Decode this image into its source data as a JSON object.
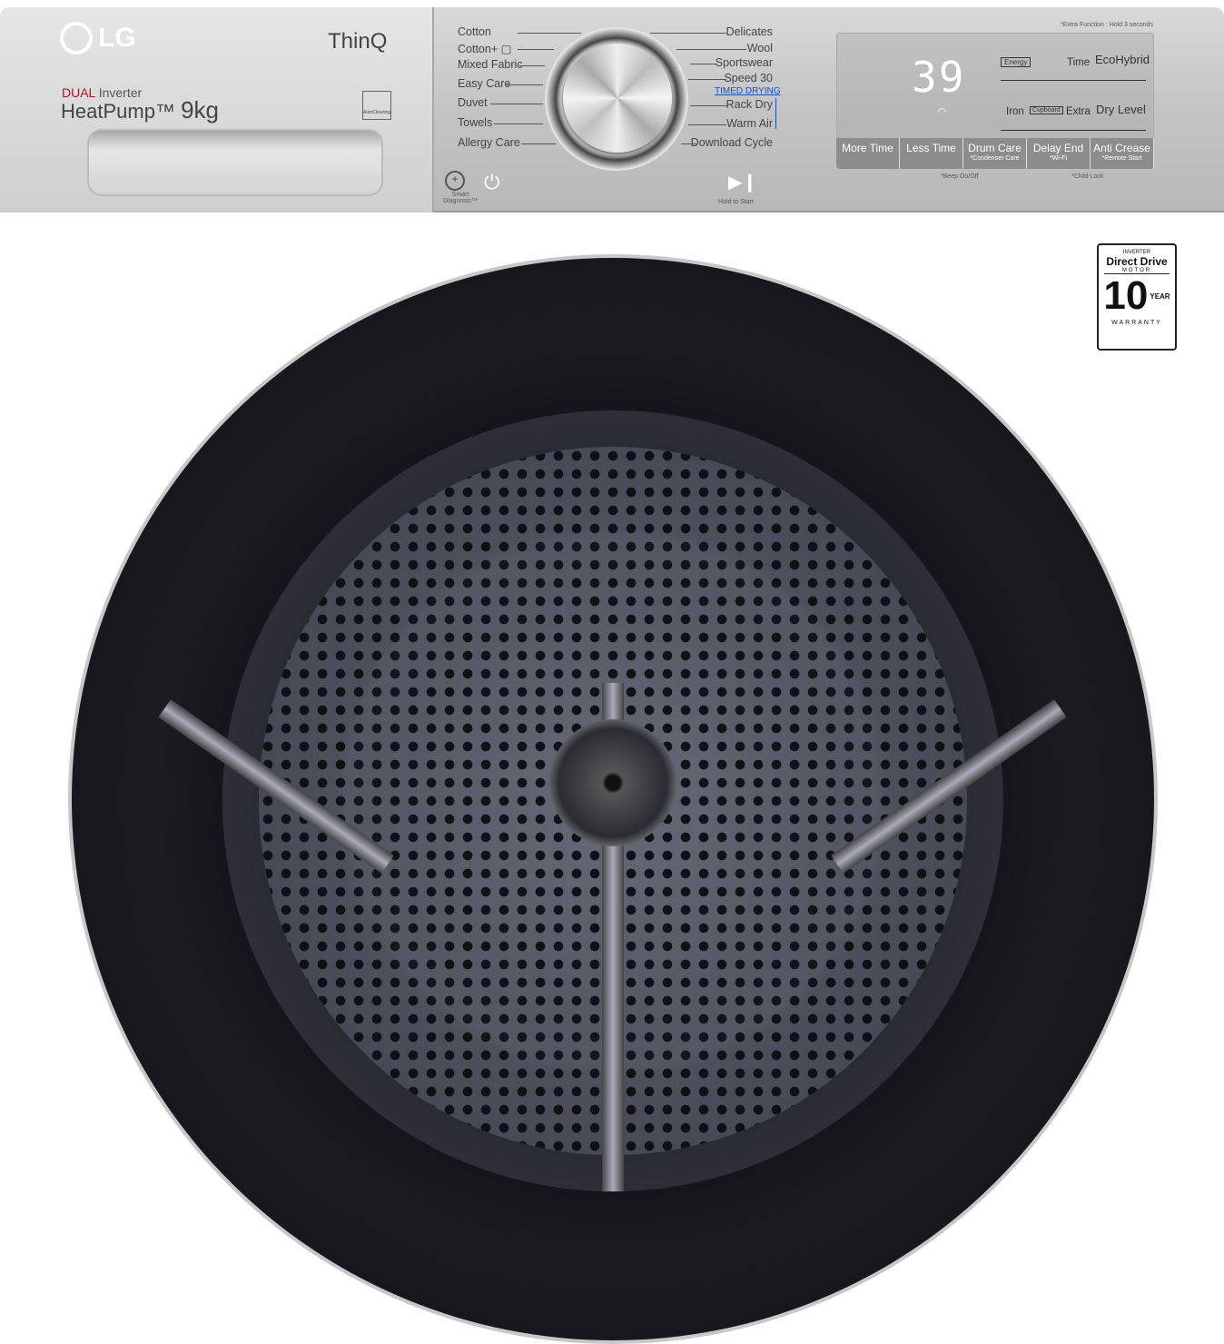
{
  "brand": {
    "logo": "LG",
    "thinq": "ThinQ",
    "dual": "DUAL",
    "inverter": "Inverter",
    "heatpump": "HeatPump™",
    "capacity": "9kg",
    "autocleaning": "AutoCleaning",
    "accent": "#b0132a"
  },
  "programs_left": [
    "Cotton",
    "Cotton+ ▢",
    "Mixed Fabric",
    "Easy Care",
    "Duvet",
    "Towels",
    "Allergy Care"
  ],
  "programs_right": [
    "Delicates",
    "Wool",
    "Sportswear",
    "Speed 30",
    "Rack Dry",
    "Warm Air",
    "Download Cycle"
  ],
  "timed_drying": "TIMED DRYING",
  "controls": {
    "smart_diagnosis": "Smart Diagnosis™",
    "power_icon": "power-icon",
    "start_icon": "play-pause-icon",
    "hold_to_start": "Hold to Start"
  },
  "display": {
    "extra_note": "*Extra Function : Hold 3 seconds",
    "value": "39",
    "energy": "Energy",
    "time": "Time",
    "ecohybrid": "EcoHybrid",
    "iron": "Iron",
    "cupboard": "Cupboard",
    "extra": "Extra",
    "dry_level": "Dry Level",
    "buttons": [
      {
        "label": "More Time",
        "sub": ""
      },
      {
        "label": "Less Time",
        "sub": ""
      },
      {
        "label": "Drum Care",
        "sub": "*Condenser Care"
      },
      {
        "label": "Delay End",
        "sub": "*Wi-Fi"
      },
      {
        "label": "Anti Crease",
        "sub": "*Remote Start"
      }
    ],
    "beep": "*Beep On/Off",
    "child_lock": "*Child Lock"
  },
  "badge": {
    "top": "INVERTER",
    "title": "Direct Drive",
    "motor": "MOTOR",
    "years": "10",
    "year": "YEAR",
    "warranty": "WARRANTY"
  }
}
